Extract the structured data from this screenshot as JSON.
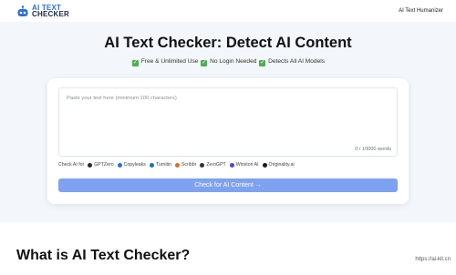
{
  "header": {
    "logo_line1": "AI TEXT",
    "logo_line2": "CHECKER",
    "nav_link": "AI Text Humanizer"
  },
  "hero": {
    "title": "AI Text Checker: Detect AI Content",
    "features": [
      " Free & Unlimited Use ",
      " No Login Needed ",
      " Detects All AI Models"
    ]
  },
  "editor": {
    "placeholder": "Paste your text here (minimum 100 characters)",
    "counter": "0 / 10000 words"
  },
  "checkers": {
    "label": "Check AI for",
    "items": [
      {
        "name": "GPTZero",
        "color": "#2b2b2b"
      },
      {
        "name": "Copyleaks",
        "color": "#2f6fd6"
      },
      {
        "name": "Turnitin",
        "color": "#1f6fb2"
      },
      {
        "name": "Scribbr",
        "color": "#e06a2c"
      },
      {
        "name": "ZeroGPT",
        "color": "#333333"
      },
      {
        "name": "Winston AI",
        "color": "#5a3fd0"
      },
      {
        "name": "Originality.ai",
        "color": "#1a1a1a"
      }
    ]
  },
  "button": {
    "label": "Check for AI Content →"
  },
  "section": {
    "title": "What is AI Text Checker?"
  },
  "watermark": "https://ai-kit.cn",
  "colors": {
    "accent": "#7ea2f0",
    "brand": "#2f6fd6",
    "check": "#4caf50"
  }
}
